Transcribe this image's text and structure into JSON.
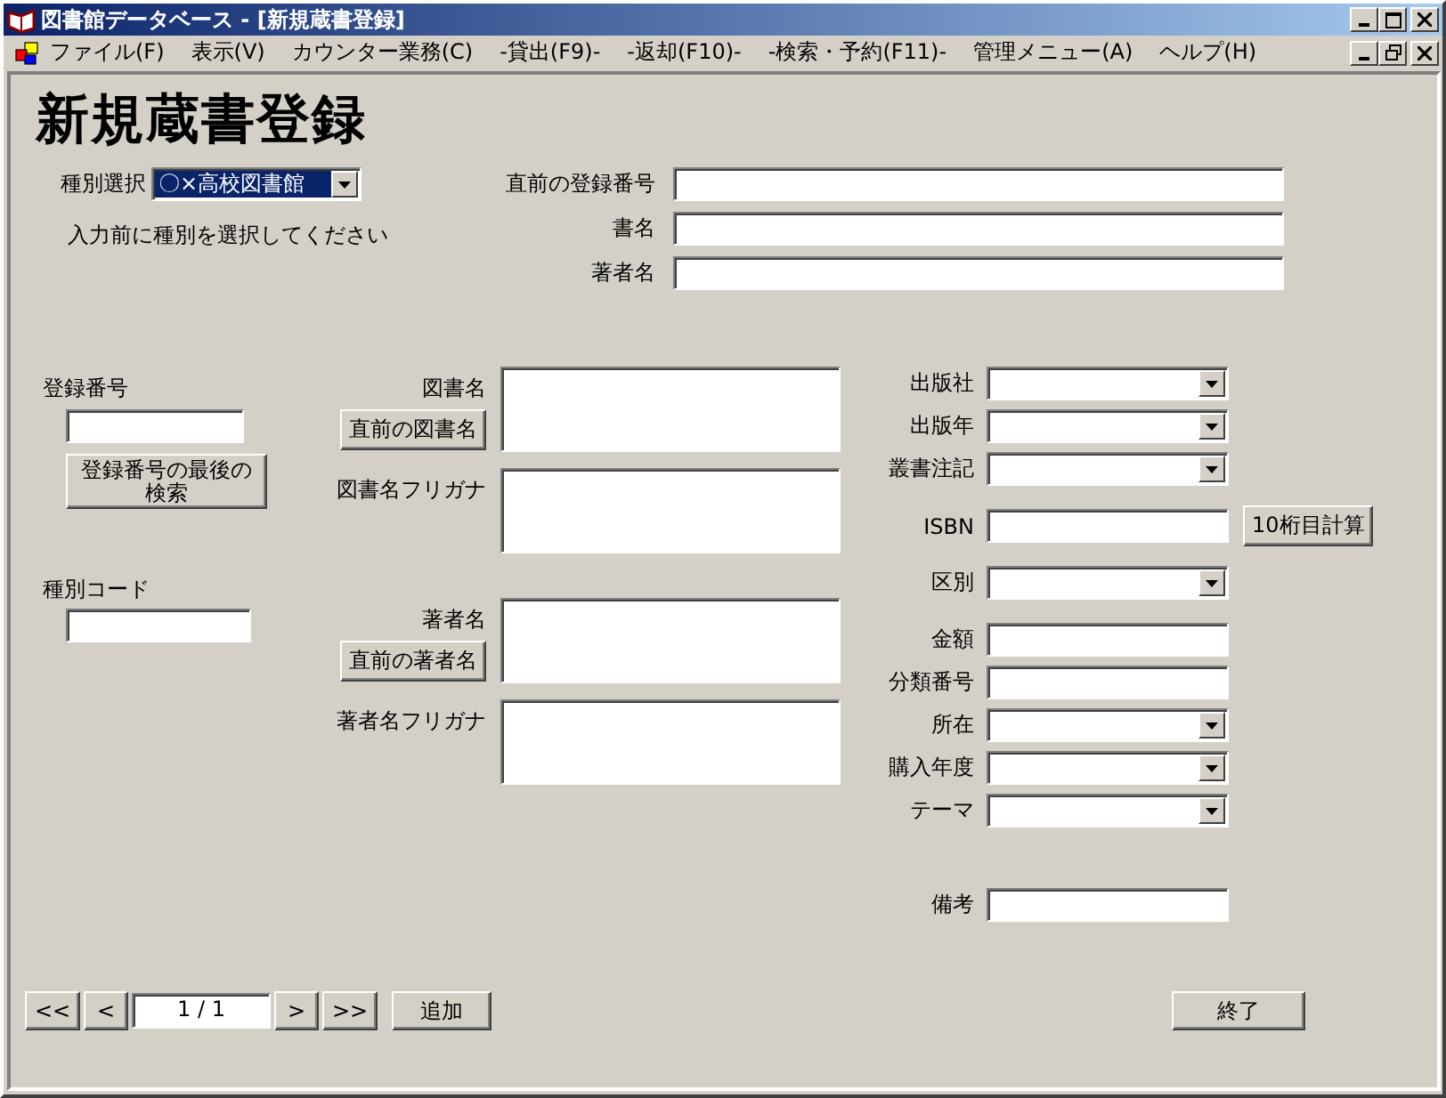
{
  "window": {
    "title": "図書館データベース - [新規蔵書登録]"
  },
  "menu": [
    "ファイル(F)",
    "表示(V)",
    "カウンター業務(C)",
    "-貸出(F9)-",
    "-返却(F10)-",
    "-検索・予約(F11)-",
    "管理メニュー(A)",
    "ヘルプ(H)"
  ],
  "form": {
    "title": "新規蔵書登録",
    "type_select": {
      "label": "種別選択",
      "value": "〇×高校図書館",
      "highlighted": true
    },
    "hint": "入力前に種別を選択してください",
    "top_fields": [
      {
        "label": "直前の登録番号"
      },
      {
        "label": "書名"
      },
      {
        "label": "著者名"
      }
    ],
    "registration_number": {
      "label": "登録番号",
      "button": "登録番号の最後の検索"
    },
    "type_code": {
      "label": "種別コード"
    },
    "middle_groups": [
      [
        {
          "label": "図書名",
          "button": "直前の図書名"
        },
        {
          "label": "図書名フリガナ"
        }
      ],
      [
        {
          "label": "著者名",
          "button": "直前の著者名"
        },
        {
          "label": "著者名フリガナ"
        }
      ]
    ],
    "right_groups": [
      [
        {
          "label": "出版社",
          "kind": "combo"
        },
        {
          "label": "出版年",
          "kind": "combo"
        },
        {
          "label": "叢書注記",
          "kind": "combo"
        }
      ],
      [
        {
          "label": "ISBN",
          "kind": "text",
          "button": "10桁目計算"
        }
      ],
      [
        {
          "label": "区別",
          "kind": "combo"
        }
      ],
      [
        {
          "label": "金額",
          "kind": "text"
        },
        {
          "label": "分類番号",
          "kind": "text"
        },
        {
          "label": "所在",
          "kind": "combo"
        },
        {
          "label": "購入年度",
          "kind": "combo"
        },
        {
          "label": "テーマ",
          "kind": "combo"
        }
      ],
      [
        {
          "label": "備考",
          "kind": "text"
        }
      ]
    ],
    "nav": {
      "first": "<<",
      "prev": "<",
      "counter": "1 / 1",
      "next": ">",
      "last": ">>"
    },
    "add_button": "追加",
    "close_button": "終了"
  }
}
